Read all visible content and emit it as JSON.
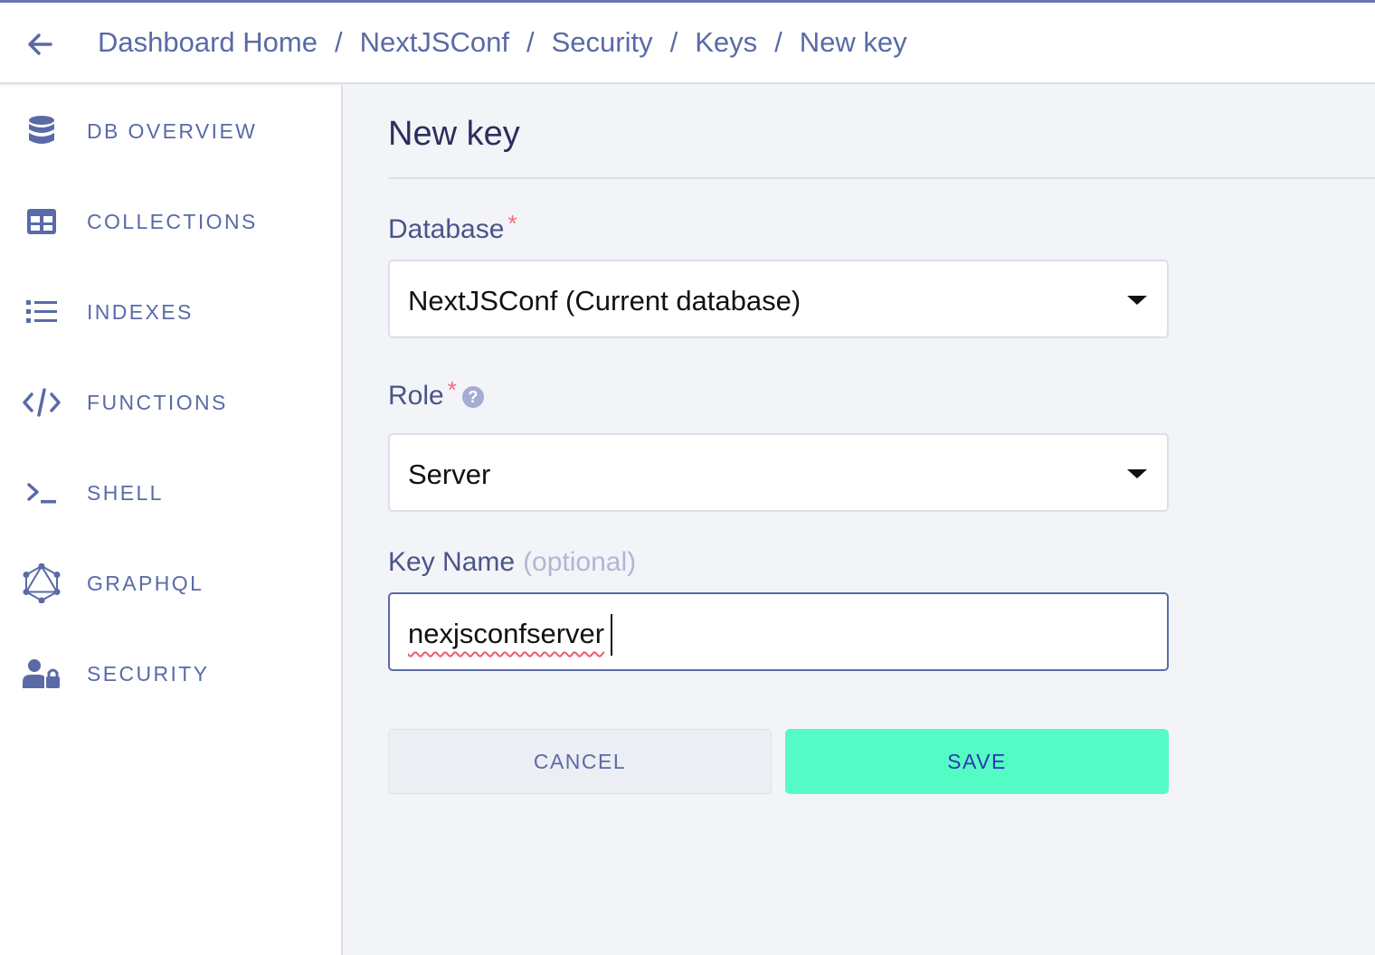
{
  "header": {
    "breadcrumbs": [
      "Dashboard Home",
      "NextJSConf",
      "Security",
      "Keys",
      "New key"
    ],
    "separator": "/"
  },
  "sidebar": {
    "items": [
      {
        "label": "DB OVERVIEW",
        "icon": "database-icon"
      },
      {
        "label": "COLLECTIONS",
        "icon": "table-grid-icon"
      },
      {
        "label": "INDEXES",
        "icon": "list-icon"
      },
      {
        "label": "FUNCTIONS",
        "icon": "code-icon"
      },
      {
        "label": "SHELL",
        "icon": "terminal-icon"
      },
      {
        "label": "GRAPHQL",
        "icon": "graphql-icon"
      },
      {
        "label": "SECURITY",
        "icon": "user-lock-icon"
      }
    ]
  },
  "form": {
    "title": "New key",
    "database": {
      "label": "Database",
      "required_mark": "*",
      "value": "NextJSConf (Current database)"
    },
    "role": {
      "label": "Role",
      "required_mark": "*",
      "help": "?",
      "value": "Server"
    },
    "key_name": {
      "label": "Key Name",
      "optional": "(optional)",
      "value": "nexjsconfserver"
    },
    "cancel_label": "CANCEL",
    "save_label": "SAVE"
  },
  "colors": {
    "accent": "#5a6aa7",
    "save": "#55fbc5",
    "required": "#f26d7d"
  }
}
